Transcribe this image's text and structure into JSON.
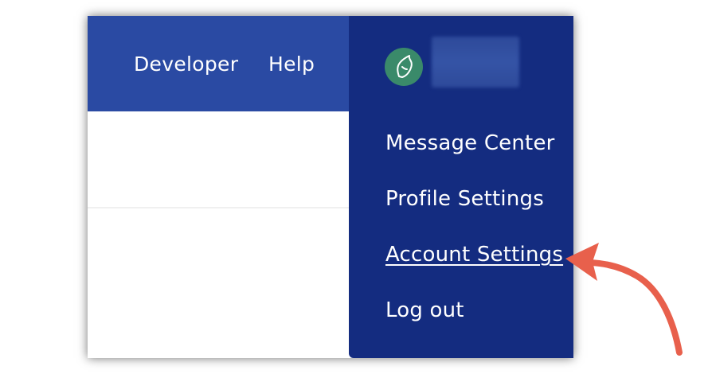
{
  "header": {
    "nav": [
      {
        "label": "Developer"
      },
      {
        "label": "Help"
      }
    ]
  },
  "dropdown": {
    "items": [
      {
        "label": "Message Center"
      },
      {
        "label": "Profile Settings"
      },
      {
        "label": "Account Settings"
      },
      {
        "label": "Log out"
      }
    ]
  },
  "colors": {
    "header_bg": "#2a4aa3",
    "dropdown_bg": "#142c80",
    "avatar_bg": "#3a8a6a",
    "annotation_arrow": "#e8604c"
  },
  "icons": {
    "avatar": "user-avatar-icon",
    "arrow": "annotation-arrow-icon"
  }
}
